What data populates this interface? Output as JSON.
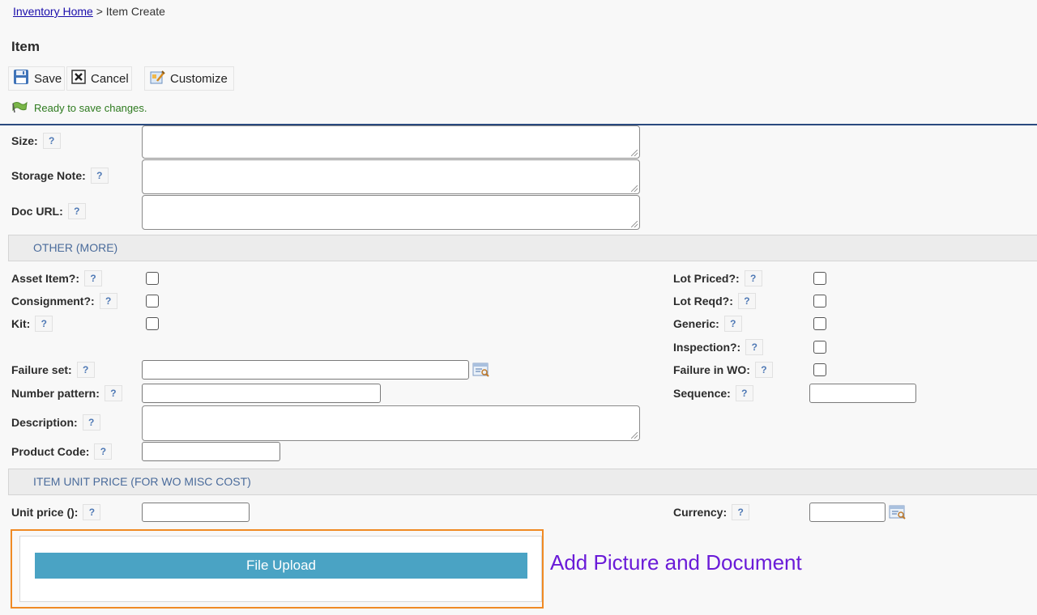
{
  "breadcrumb": {
    "home": "Inventory Home",
    "separator": " > ",
    "current": "Item Create"
  },
  "page_title": "Item",
  "toolbar": {
    "save": "Save",
    "cancel": "Cancel",
    "customize": "Customize"
  },
  "status": "Ready to save changes.",
  "help_glyph": "?",
  "fields": {
    "size": "Size:",
    "storage_note": "Storage Note:",
    "doc_url": "Doc URL:",
    "asset_item": "Asset Item?:",
    "consignment": "Consignment?:",
    "kit": "Kit:",
    "lot_priced": "Lot Priced?:",
    "lot_reqd": "Lot Reqd?:",
    "generic": "Generic:",
    "inspection": "Inspection?:",
    "failure_set": "Failure set:",
    "failure_in_wo": "Failure in WO:",
    "number_pattern": "Number pattern:",
    "sequence": "Sequence:",
    "description": "Description:",
    "product_code": "Product Code:",
    "unit_price": "Unit price ():",
    "currency": "Currency:"
  },
  "sections": {
    "other": "OTHER (MORE)",
    "unit_price": "ITEM UNIT PRICE (FOR WO MISC COST)"
  },
  "upload": {
    "button": "File Upload"
  },
  "annotation": "Add Picture and Document",
  "colors": {
    "accent": "#2a4a7f",
    "upload_button": "#4aa3c4",
    "highlight_border": "#f08a24",
    "annotation": "#6a1bd8"
  }
}
